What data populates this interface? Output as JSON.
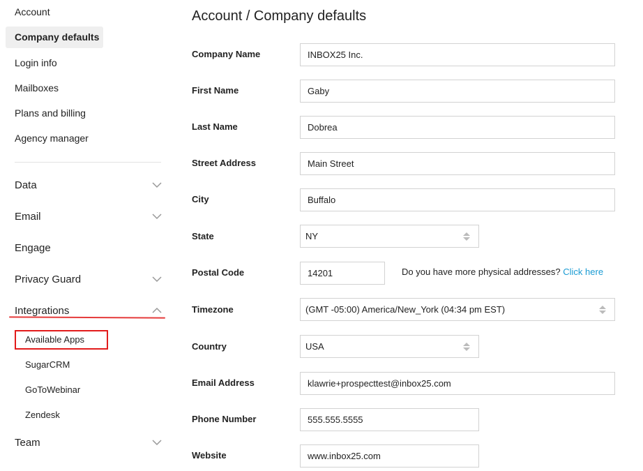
{
  "sidebar": {
    "account": "Account",
    "company_defaults": "Company defaults",
    "login_info": "Login info",
    "mailboxes": "Mailboxes",
    "plans_billing": "Plans and billing",
    "agency_manager": "Agency manager",
    "sections": {
      "data": "Data",
      "email": "Email",
      "engage": "Engage",
      "privacy_guard": "Privacy Guard",
      "integrations": "Integrations",
      "team": "Team"
    },
    "integrations_items": {
      "available_apps": "Available Apps",
      "sugarcrm": "SugarCRM",
      "gotowebinar": "GoToWebinar",
      "zendesk": "Zendesk"
    }
  },
  "main": {
    "title": "Account / Company defaults",
    "labels": {
      "company_name": "Company Name",
      "first_name": "First Name",
      "last_name": "Last Name",
      "street_address": "Street Address",
      "city": "City",
      "state": "State",
      "postal_code": "Postal Code",
      "timezone": "Timezone",
      "country": "Country",
      "email_address": "Email Address",
      "phone_number": "Phone Number",
      "website": "Website"
    },
    "values": {
      "company_name": "INBOX25 Inc.",
      "first_name": "Gaby",
      "last_name": "Dobrea",
      "street_address": "Main Street",
      "city": "Buffalo",
      "state": "NY",
      "postal_code": "14201",
      "timezone": "(GMT -05:00) America/New_York (04:34 pm EST)",
      "country": "USA",
      "email_address": "klawrie+prospecttest@inbox25.com",
      "phone_number": "555.555.5555",
      "website": "www.inbox25.com"
    },
    "address_note": "Do you have more physical addresses?",
    "address_link": "Click here"
  },
  "colors": {
    "link": "#1a9bd3",
    "annotation_red": "#e21b1b",
    "active_bg": "#efefef"
  }
}
